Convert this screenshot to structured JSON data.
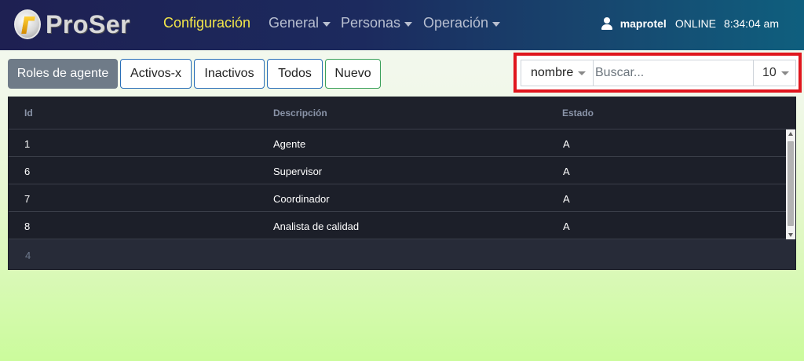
{
  "app": {
    "logo_text": "ProSer"
  },
  "nav": {
    "items": [
      {
        "label": "Configuración",
        "active": true,
        "dropdown": false
      },
      {
        "label": "General",
        "active": false,
        "dropdown": true
      },
      {
        "label": "Personas",
        "active": false,
        "dropdown": true
      },
      {
        "label": "Operación",
        "active": false,
        "dropdown": true
      }
    ]
  },
  "user": {
    "name": "maprotel",
    "status": "ONLINE",
    "time": "8:34:04 am"
  },
  "toolbar": {
    "buttons": [
      {
        "label": "Roles de agente"
      },
      {
        "label": "Activos-x"
      },
      {
        "label": "Inactivos"
      },
      {
        "label": "Todos"
      },
      {
        "label": "Nuevo"
      }
    ]
  },
  "search": {
    "field": "nombre",
    "placeholder": "Buscar...",
    "value": "",
    "page_size": "10"
  },
  "table": {
    "columns": [
      "Id",
      "Descripción",
      "Estado"
    ],
    "rows": [
      [
        "1",
        "Agente",
        "A"
      ],
      [
        "6",
        "Supervisor",
        "A"
      ],
      [
        "7",
        "Coordinador",
        "A"
      ],
      [
        "8",
        "Analista de calidad",
        "A"
      ]
    ],
    "row_count": "4"
  },
  "colors": {
    "active_nav": "#f3e64a",
    "primary_button": "#6f7b88",
    "highlight_frame": "#e0161d",
    "table_bg": "#1c1f29"
  }
}
